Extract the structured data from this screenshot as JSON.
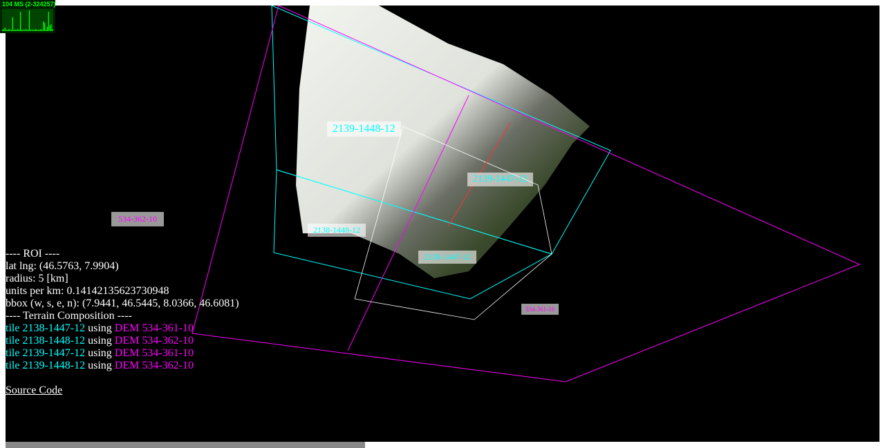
{
  "stats": {
    "text": "104 MS (2-324257)",
    "bars": [
      2,
      3,
      5,
      2,
      2,
      3,
      2,
      2,
      20,
      2,
      2,
      2,
      3,
      2,
      28,
      2,
      2,
      2,
      3,
      2,
      2,
      30,
      2,
      2,
      2,
      2,
      3,
      2,
      2,
      2,
      3,
      2,
      14,
      12,
      2,
      6,
      28,
      8,
      10,
      3
    ]
  },
  "colors": {
    "tile": "#00ffff",
    "dem": "#ff00ff",
    "text": "#ffffff",
    "stats": "#00ff00"
  },
  "info": {
    "roi_header": "---- ROI ----",
    "latlng": "lat lng: (46.5763, 7.9904)",
    "radius": "radius: 5 [km]",
    "units": "units per km: 0.14142135623730948",
    "bbox": "bbox (w, s, e, n): (7.9441, 46.5445, 8.0366, 46.6081)",
    "terrain_header": "---- Terrain Composition ----",
    "tiles": [
      {
        "tile": "tile 2138-1447-12",
        "using": " using ",
        "dem": "DEM 534-361-10"
      },
      {
        "tile": "tile 2138-1448-12",
        "using": " using ",
        "dem": "DEM 534-362-10"
      },
      {
        "tile": "tile 2139-1447-12",
        "using": " using ",
        "dem": "DEM 534-361-10"
      },
      {
        "tile": "tile 2139-1448-12",
        "using": " using ",
        "dem": "DEM 534-362-10"
      }
    ],
    "source_link": "Source Code"
  },
  "scene_labels": {
    "t2139_1448": "2139-1448-12",
    "t2139_1447": "2139-1447-12",
    "t2138_1448": "2138-1448-12",
    "t2138_1447": "2138-1447-12",
    "d534_362": "534-362-10",
    "d534_361": "534-361-10"
  }
}
